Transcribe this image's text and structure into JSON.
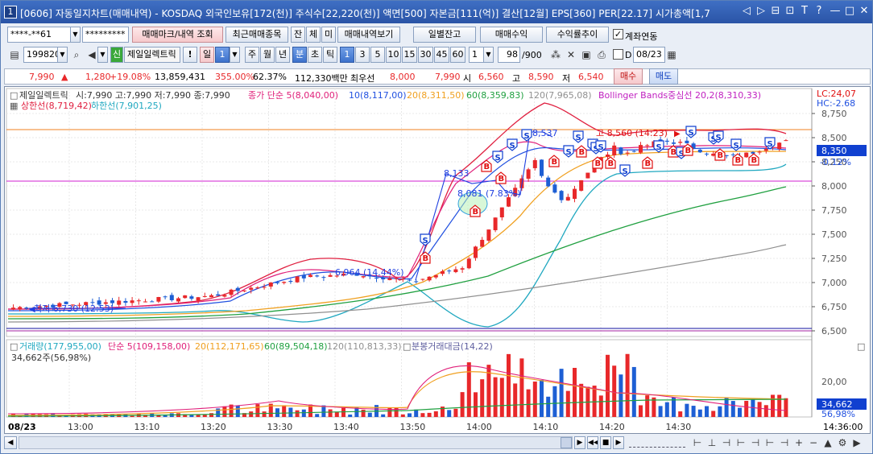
{
  "window": {
    "number": "1",
    "title": "[0606] 자동일지차트(매매내역) - KOSDAQ 외국인보유[172(천)] 주식수[22,220(천)] 액면[500] 자본금[111(억)] 결산[12월] EPS[360] PER[22.17] 시가총액[1,7",
    "controls": [
      "◁",
      "▷",
      "⊟",
      "⊡",
      "T",
      "?",
      "—",
      "□",
      "✕"
    ]
  },
  "toolbar1": {
    "account": "****-**61",
    "password": "*********",
    "mark_btn": "매매마크/내역 조회",
    "recent_btn": "최근매매종목",
    "tab_jan": "잔",
    "tab_che": "체",
    "tab_mi": "미",
    "history_btn": "매매내역보기",
    "daily_balance_btn": "일별잔고",
    "trade_profit_btn": "매매수익",
    "profit_trend_btn": "수익률추이",
    "link_label": "계좌연동",
    "link_checked": "✓"
  },
  "toolbar2": {
    "code": "199820",
    "sin": "신",
    "stock_name": "제일일렉트릭",
    "period_day": "일",
    "period_num": "1",
    "period_week": "주",
    "period_month": "월",
    "period_year": "년",
    "period_min": "분",
    "period_sec": "초",
    "period_tick": "틱",
    "intervals": [
      "1",
      "3",
      "5",
      "10",
      "15",
      "30",
      "45",
      "60"
    ],
    "interval_sel": "1",
    "count": "98",
    "count_total": "/900",
    "date_label": "D",
    "date": "08/23"
  },
  "quote": {
    "price": "7,990",
    "arrow": "▲",
    "change": "1,280",
    "change_pct": "+19.08%",
    "volume": "13,859,431",
    "vol_ratio": "355.00%",
    "rate2": "62.37%",
    "amount": "112,330백만",
    "best_ask_label": "최우선",
    "best_ask": "8,000",
    "best_bid": "7,990",
    "open_label": "시",
    "open": "6,560",
    "high_label": "고",
    "high": "8,590",
    "low_label": "저",
    "low": "6,540",
    "buy_btn": "매수",
    "sell_btn": "매도"
  },
  "price_panel": {
    "legend1": {
      "name": "제일일렉트릭",
      "ohlc": "시:7,990 고:7,990 저:7,990 종:7,990",
      "ma_title": "종가 단순 5(8,040,00)",
      "ma10": "10(8,117,00)",
      "ma20": "20(8,311,50)",
      "ma60": "60(8,359,83)",
      "ma120": "120(7,965,08)",
      "bb": "Bollinger Bands중심선 20,2(8,310,33)"
    },
    "legend2": {
      "upper": "상한선(8,719,42)",
      "lower": "하한선(7,901,25)"
    },
    "lc": "LC:24,07",
    "hc": "HC:-2.68",
    "current_price": "8,350",
    "current_pct": "-0.12%",
    "annotations": {
      "high": "고 8,560 (14:23)",
      "low": "최저 6,730 (12:53)",
      "p8537": "8,537",
      "p8133": "8,133",
      "p8081": "8,081 (7.83%)",
      "p6964": "6,964 (14.44%)"
    },
    "yticks": [
      "8,750",
      "8,500",
      "8,250",
      "8,000",
      "7,750",
      "7,500",
      "7,250",
      "7,000",
      "6,750",
      "6,500"
    ]
  },
  "volume_panel": {
    "legend": "거래량(177,955,00)",
    "ma5": "단순 5(109,158,00)",
    "ma20": "20(112,171,65)",
    "ma60": "60(89,504,18)",
    "ma120": "120(110,813,33)",
    "amount": "분봉거래대금(14,22)",
    "sub": "34,662주(56,98%)",
    "ytick": "20,00",
    "cur_vol": "34,662",
    "cur_pct": "56,98%"
  },
  "xaxis": {
    "date": "08/23",
    "ticks": [
      "13:00",
      "13:10",
      "13:20",
      "13:30",
      "13:40",
      "13:50",
      "14:00",
      "14:10",
      "14:20",
      "14:30"
    ],
    "end_time": "14:36:00"
  },
  "colors": {
    "up": "#e8282a",
    "down": "#1e5fd4",
    "ma5": "#e0207a",
    "ma10": "#2050e0",
    "ma20": "#f0a020",
    "ma60": "#20a040",
    "ma120": "#909090",
    "bb": "#20a8c0"
  },
  "chart_data": {
    "type": "candlestick",
    "price": {
      "ylim": [
        6500,
        8800
      ],
      "candles_sample": [
        {
          "time": "13:50",
          "open": 7100,
          "close": 7500,
          "high": 7550,
          "low": 7050
        },
        {
          "time": "14:00",
          "open": 8300,
          "close": 8480,
          "high": 8537,
          "low": 8250
        },
        {
          "time": "14:23",
          "open": 8450,
          "close": 8520,
          "high": 8560,
          "low": 8400
        }
      ]
    },
    "volume": {
      "ylim": [
        0,
        26
      ]
    }
  }
}
